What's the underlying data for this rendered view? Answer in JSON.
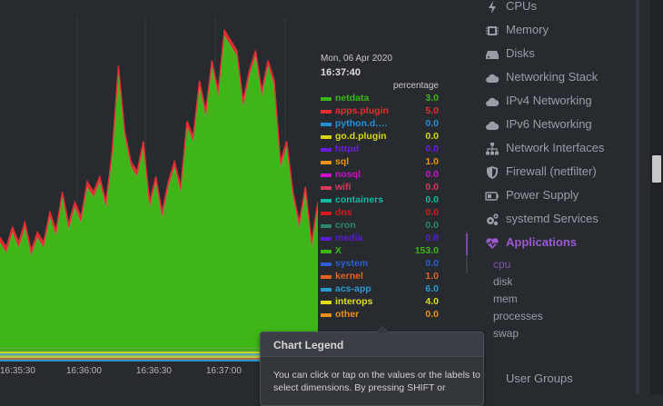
{
  "legend": {
    "date": "Mon, 06 Apr 2020",
    "time": "16:37:40",
    "units": "percentage",
    "rows": [
      {
        "name": "netdata",
        "value": "3.0",
        "color": "#3fb618"
      },
      {
        "name": "apps.plugin",
        "value": "5.0",
        "color": "#e62e2e"
      },
      {
        "name": "python.d.…",
        "value": "0.0",
        "color": "#2490d9"
      },
      {
        "name": "go.d.plugin",
        "value": "0.0",
        "color": "#d6d615"
      },
      {
        "name": "httpd",
        "value": "0.0",
        "color": "#6b1cd9"
      },
      {
        "name": "sql",
        "value": "1.0",
        "color": "#e89414"
      },
      {
        "name": "nosql",
        "value": "0.0",
        "color": "#cc10cc"
      },
      {
        "name": "wifi",
        "value": "0.0",
        "color": "#d93a5c"
      },
      {
        "name": "containers",
        "value": "0.0",
        "color": "#16b8a0"
      },
      {
        "name": "dns",
        "value": "0.0",
        "color": "#d41a1a"
      },
      {
        "name": "cron",
        "value": "0.0",
        "color": "#2a8a6a"
      },
      {
        "name": "media",
        "value": "0.0",
        "color": "#5a1ccf"
      },
      {
        "name": "X",
        "value": "153.0",
        "color": "#3fb618"
      },
      {
        "name": "system",
        "value": "0.0",
        "color": "#2c5fd1"
      },
      {
        "name": "kernel",
        "value": "1.0",
        "color": "#e06420"
      },
      {
        "name": "acs-app",
        "value": "6.0",
        "color": "#2a9bd1"
      },
      {
        "name": "interops",
        "value": "4.0",
        "color": "#dede1a"
      },
      {
        "name": "other",
        "value": "0.0",
        "color": "#e8901a"
      }
    ]
  },
  "chart_data": {
    "type": "area",
    "stacked": true,
    "x_ticks": [
      "16:35:30",
      "16:36:00",
      "16:36:30",
      "16:37:00"
    ],
    "series": [
      {
        "name": "X",
        "color": "#3fb618",
        "values": [
          105,
          95,
          115,
          100,
          120,
          92,
          110,
          100,
          130,
          112,
          150,
          118,
          140,
          125,
          160,
          150,
          165,
          140,
          190,
          275,
          210,
          180,
          170,
          200,
          140,
          165,
          130,
          160,
          180,
          155,
          220,
          205,
          260,
          230,
          280,
          250,
          310,
          300,
          290,
          240,
          270,
          290,
          250,
          280,
          260,
          180,
          200,
          150,
          120,
          155,
          100,
          140
        ]
      },
      {
        "name": "netdata",
        "color": "#3fb618",
        "values": [
          3,
          3,
          3,
          3,
          3,
          3,
          3,
          3,
          3,
          3,
          3,
          3,
          3,
          3,
          3,
          3,
          3,
          3,
          3,
          3,
          3,
          3,
          3,
          3,
          3,
          3,
          3,
          3,
          3,
          3,
          3,
          3,
          3,
          3,
          3,
          3,
          3,
          3,
          3,
          3,
          3,
          3,
          3,
          3,
          3,
          3,
          3,
          3,
          3,
          3,
          3,
          3
        ]
      },
      {
        "name": "apps.plugin",
        "color": "#e62e2e",
        "values": [
          5,
          5,
          5,
          5,
          5,
          5,
          5,
          5,
          5,
          5,
          5,
          5,
          5,
          5,
          5,
          5,
          5,
          5,
          5,
          5,
          5,
          5,
          5,
          5,
          5,
          5,
          5,
          5,
          5,
          5,
          5,
          5,
          5,
          5,
          5,
          5,
          5,
          5,
          5,
          5,
          5,
          5,
          5,
          5,
          5,
          5,
          5,
          5,
          5,
          5,
          5,
          5
        ]
      },
      {
        "name": "acs-app",
        "color": "#2a9bd1",
        "values": [
          6,
          6,
          6,
          6,
          6,
          6,
          6,
          6,
          6,
          6,
          6,
          6,
          6,
          6,
          6,
          6,
          6,
          6,
          6,
          6,
          6,
          6,
          6,
          6,
          6,
          6,
          6,
          6,
          6,
          6,
          6,
          6,
          6,
          6,
          6,
          6,
          6,
          6,
          6,
          6,
          6,
          6,
          6,
          6,
          6,
          6,
          6,
          6,
          6,
          6,
          6,
          6
        ]
      },
      {
        "name": "interops",
        "color": "#dede1a",
        "values": [
          4,
          4,
          4,
          4,
          4,
          4,
          4,
          4,
          4,
          4,
          4,
          4,
          4,
          4,
          4,
          4,
          4,
          4,
          4,
          4,
          4,
          4,
          4,
          4,
          4,
          4,
          4,
          4,
          4,
          4,
          4,
          4,
          4,
          4,
          4,
          4,
          4,
          4,
          4,
          4,
          4,
          4,
          4,
          4,
          4,
          4,
          4,
          4,
          4,
          4,
          4,
          4
        ]
      }
    ]
  },
  "sidebar": {
    "items": [
      {
        "label": "CPUs",
        "icon": "bolt"
      },
      {
        "label": "Memory",
        "icon": "chip"
      },
      {
        "label": "Disks",
        "icon": "hdd"
      },
      {
        "label": "Networking Stack",
        "icon": "cloud"
      },
      {
        "label": "IPv4 Networking",
        "icon": "cloud"
      },
      {
        "label": "IPv6 Networking",
        "icon": "cloud"
      },
      {
        "label": "Network Interfaces",
        "icon": "sitemap"
      },
      {
        "label": "Firewall (netfilter)",
        "icon": "shield"
      },
      {
        "label": "Power Supply",
        "icon": "battery"
      },
      {
        "label": "systemd Services",
        "icon": "cogs"
      },
      {
        "label": "Applications",
        "icon": "heartbeat"
      }
    ],
    "subitems": [
      "cpu",
      "disk",
      "mem",
      "processes",
      "swap"
    ],
    "partial_item": "User Groups",
    "active_color": "#9b59d0"
  },
  "tooltip": {
    "title": "Chart Legend",
    "body": "You can click or tap on the values or the labels to select dimensions. By pressing SHIFT or"
  }
}
